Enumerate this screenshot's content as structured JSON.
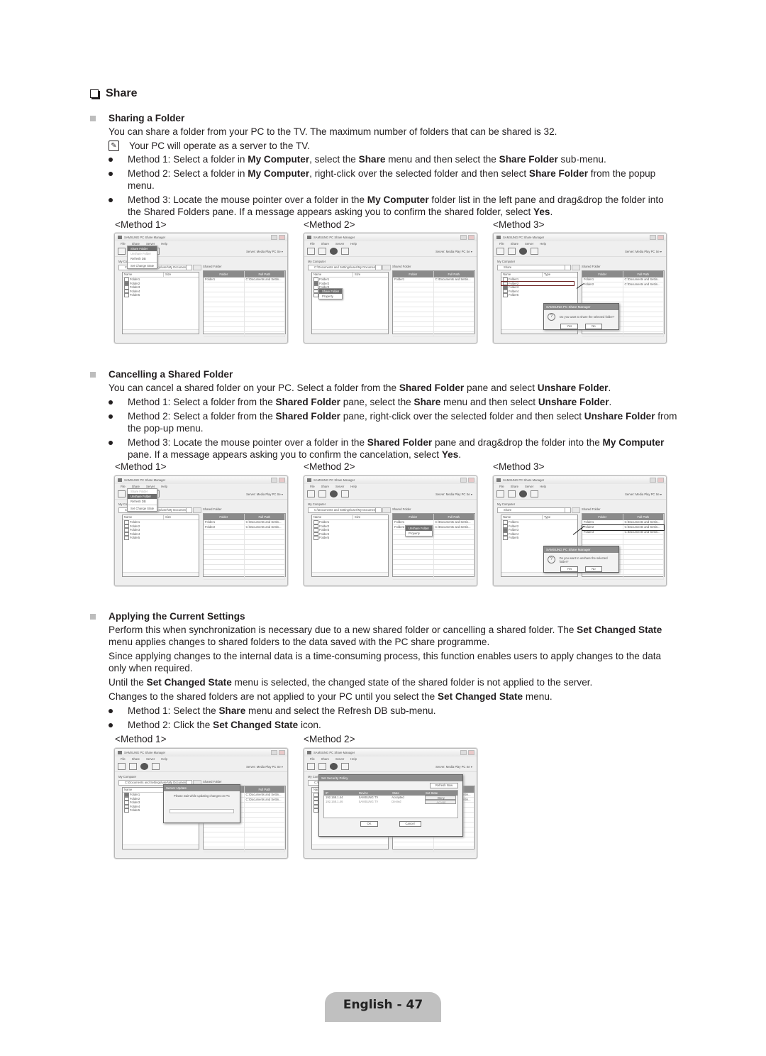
{
  "section": {
    "title": "Share",
    "icon": "checkbox-square-icon"
  },
  "sharing": {
    "title": "Sharing a Folder",
    "intro": "You can share a folder from your PC to the TV. The maximum number of folders that can be shared is 32.",
    "note": "Your PC will operate as a server to the TV.",
    "method1": {
      "pre": "Method 1: Select a folder in ",
      "b1": "My Computer",
      "mid1": ", select the ",
      "b2": "Share",
      "mid2": " menu and then select the ",
      "b3": "Share Folder",
      "post": " sub-menu."
    },
    "method2": {
      "pre": "Method 2: Select a folder in ",
      "b1": "My Computer",
      "mid1": ", right-click over the selected folder and then select ",
      "b2": "Share Folder",
      "post": " from the popup menu."
    },
    "method3": {
      "pre": "Method 3: Locate the mouse pointer over a folder in the ",
      "b1": "My Computer",
      "mid1": " folder list in the left pane and drag&drop the folder into the Shared Folders pane. If a message appears asking you to confirm the shared folder, select ",
      "b2": "Yes",
      "post": "."
    },
    "labels": [
      "<Method 1>",
      "<Method 2>",
      "<Method 3>"
    ]
  },
  "cancelling": {
    "title": "Cancelling a Shared Folder",
    "intro": {
      "pre": "You can cancel a shared folder on your PC. Select a folder from the ",
      "b1": "Shared Folder",
      "mid1": " pane and select ",
      "b2": "Unshare Folder",
      "post": "."
    },
    "method1": {
      "pre": "Method 1: Select a folder from the ",
      "b1": "Shared Folder",
      "mid1": " pane, select the ",
      "b2": "Share",
      "mid2": " menu and then select ",
      "b3": "Unshare Folder",
      "post": "."
    },
    "method2": {
      "pre": "Method 2: Select a folder from the ",
      "b1": "Shared Folder",
      "mid1": " pane, right-click over the selected folder and then select ",
      "b2": "Unshare Folder",
      "post": " from the pop-up menu."
    },
    "method3": {
      "pre": "Method 3: Locate the mouse pointer over a folder in the ",
      "b1": "Shared Folder",
      "mid1": " pane and drag&drop the folder into the ",
      "b2": "My Computer",
      "mid2": " pane. If a message appears asking you to confirm the cancelation, select ",
      "b3": "Yes",
      "post": "."
    },
    "labels": [
      "<Method 1>",
      "<Method 2>",
      "<Method 3>"
    ]
  },
  "applying": {
    "title": "Applying the Current Settings",
    "p1": {
      "pre": "Perform this when synchronization is necessary due to a new shared folder or cancelling a shared folder. The ",
      "b1": "Set Changed State",
      "post": " menu applies changes to shared folders to the data saved with the PC share programme."
    },
    "p2": "Since applying changes to the internal data is a time-consuming process, this function enables users to apply changes to the data only when required.",
    "p3": {
      "pre": "Until the ",
      "b1": "Set Changed State",
      "post": " menu is selected, the changed state of the shared folder is not applied to the server."
    },
    "p4": {
      "pre": "Changes to the shared folders are not applied to your PC until you select the ",
      "b1": "Set Changed State",
      "post": " menu."
    },
    "method1": {
      "pre": "Method 1: Select the ",
      "b1": "Share",
      "post": " menu and select the Refresh DB sub-menu."
    },
    "method2": {
      "pre": "Method 2: Click the ",
      "b1": "Set Changed State",
      "post": " icon."
    },
    "labels": [
      "<Method 1>",
      "<Method 2>"
    ]
  },
  "app": {
    "title": "SAMSUNG PC Share Manager",
    "menus": [
      "File",
      "Share",
      "Server",
      "Help"
    ],
    "server_label": "Server:",
    "server_value": "Media Play PC Se",
    "my_computer": "My Computer",
    "shared_folder": "Shared Folder",
    "path": "C:\\Documents and Settings\\user\\My Documents",
    "path_short": "Share",
    "left_cols": [
      "Name",
      "Size"
    ],
    "left_cols_type": [
      "Name",
      "Type"
    ],
    "right_cols": [
      "Folder",
      "Full Path"
    ],
    "folders": [
      "Folder1",
      "Folder2",
      "Folder3",
      "Folder4",
      "Folder5"
    ],
    "shared_rows": [
      {
        "folder": "Folder1",
        "path": "C:\\Documents and Settin..."
      },
      {
        "folder": "Folder2",
        "path": "C:\\Documents and Settin..."
      },
      {
        "folder": "Folder3",
        "path": "C:\\Documents and Settin..."
      }
    ],
    "share_menu": [
      "Share Folder",
      "Unshare Folder",
      "Refresh DB",
      "Set Change State"
    ],
    "ctx_share": [
      "Share Folder",
      "Property"
    ],
    "ctx_unshare": [
      "Unshare Folder",
      "Property"
    ],
    "confirm_share": "Do you want to share the selected folder?",
    "confirm_unshare": "Do you want to unshare the selected folder?",
    "yes": "Yes",
    "no": "No",
    "progress_title": "Server Update",
    "progress_msg": "Please wait while updating changes on PC",
    "security_title": "Set Security Policy",
    "security_refresh": "Refresh Now",
    "security_cols": [
      "IP",
      "Device",
      "State",
      "Set State"
    ],
    "security_rows": [
      {
        "ip": "192.168.1.44",
        "device": "SAMSUNG TV",
        "state": "Accepted",
        "action": "Deny"
      },
      {
        "ip": "192.168.1.46",
        "device": "SAMSUNG TV",
        "state": "Denied",
        "action": "Accept"
      }
    ],
    "ok": "OK",
    "cancel": "Cancel"
  },
  "footer": {
    "page_label": "English - 47"
  }
}
